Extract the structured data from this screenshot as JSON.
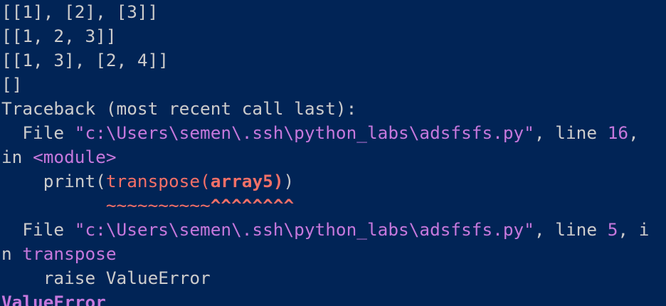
{
  "terminal": {
    "background": "#012456",
    "text_color": "#cccccc",
    "accent_magenta": "#c678dd",
    "accent_red": "#f47067",
    "output_lines": [
      "[[1], [2], [3]]",
      "[[1, 2, 3]]",
      "[[1, 3], [2, 4]]",
      "[]"
    ],
    "traceback_header": "Traceback (most recent call last):",
    "frame1": {
      "prefix": "  File ",
      "path": "\"c:\\Users\\semen\\.ssh\\python_labs\\adsfsfs.py\"",
      "line_text": ", line ",
      "line_no": "16",
      "wrap_comma": ",",
      "in_text": "in ",
      "func": "<module>",
      "code_indent": "    ",
      "code_call": "print(",
      "code_fn": "transpose(",
      "code_arg": "array5",
      "code_close_inner": ")",
      "code_close_outer": ")",
      "marker_indent": "          ",
      "marker_tildes": "~~~~~~~~~~",
      "marker_carets": "^^^^^^^^"
    },
    "frame2": {
      "prefix": "  File ",
      "path": "\"c:\\Users\\semen\\.ssh\\python_labs\\adsfsfs.py\"",
      "line_text": ", line ",
      "line_no": "5",
      "wrap_part1": ", i",
      "wrap_part2": "n ",
      "func": "transpose",
      "code": "    raise ValueError"
    },
    "error_name": "ValueError"
  }
}
